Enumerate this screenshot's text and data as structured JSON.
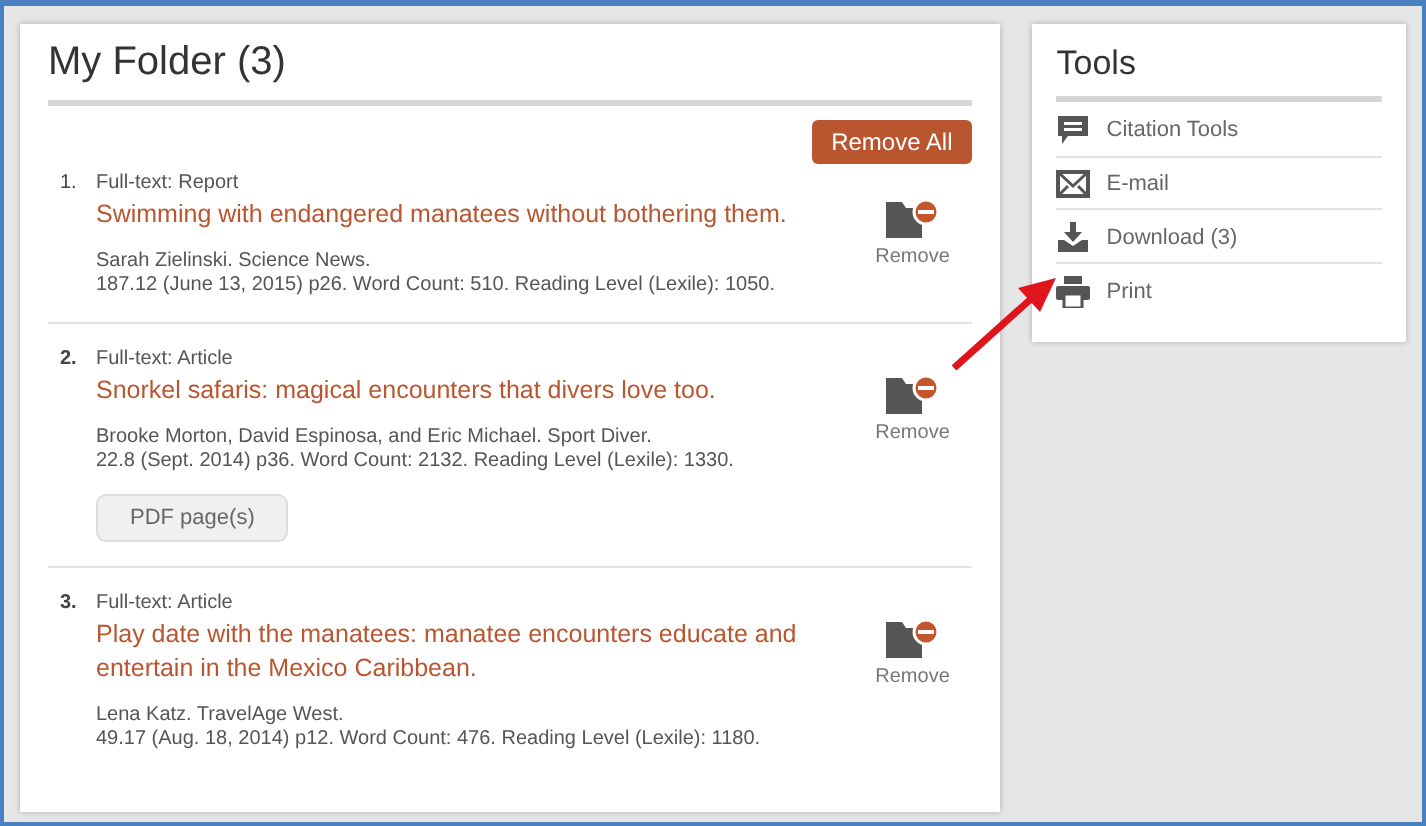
{
  "folder": {
    "title": "My Folder (3)",
    "remove_all": "Remove All",
    "records": [
      {
        "number": "1.",
        "type": "Full-text: Report",
        "title": "Swimming with endangered manatees without bothering them.",
        "source": "Sarah Zielinski. Science News.",
        "details": "187.12 (June 13, 2015) p26. Word Count: 510. Reading Level (Lexile): 1050.",
        "remove": "Remove"
      },
      {
        "number": "2.",
        "type": "Full-text: Article",
        "title": "Snorkel safaris: magical encounters that divers love too.",
        "source": "Brooke Morton, David Espinosa, and Eric Michael. Sport Diver.",
        "details": "22.8 (Sept. 2014) p36. Word Count: 2132. Reading Level (Lexile): 1330.",
        "pdf_button": "PDF page(s)",
        "remove": "Remove"
      },
      {
        "number": "3.",
        "type": "Full-text: Article",
        "title": "Play date with the manatees: manatee encounters educate and entertain in the Mexico Caribbean.",
        "source": "Lena Katz. TravelAge West.",
        "details": "49.17 (Aug. 18, 2014) p12. Word Count: 476. Reading Level (Lexile): 1180.",
        "remove": "Remove"
      }
    ]
  },
  "tools": {
    "title": "Tools",
    "items": [
      {
        "kind": "citation",
        "label": "Citation Tools"
      },
      {
        "kind": "email",
        "label": "E-mail"
      },
      {
        "kind": "download",
        "label": "Download (3)"
      },
      {
        "kind": "print",
        "label": "Print"
      }
    ]
  }
}
